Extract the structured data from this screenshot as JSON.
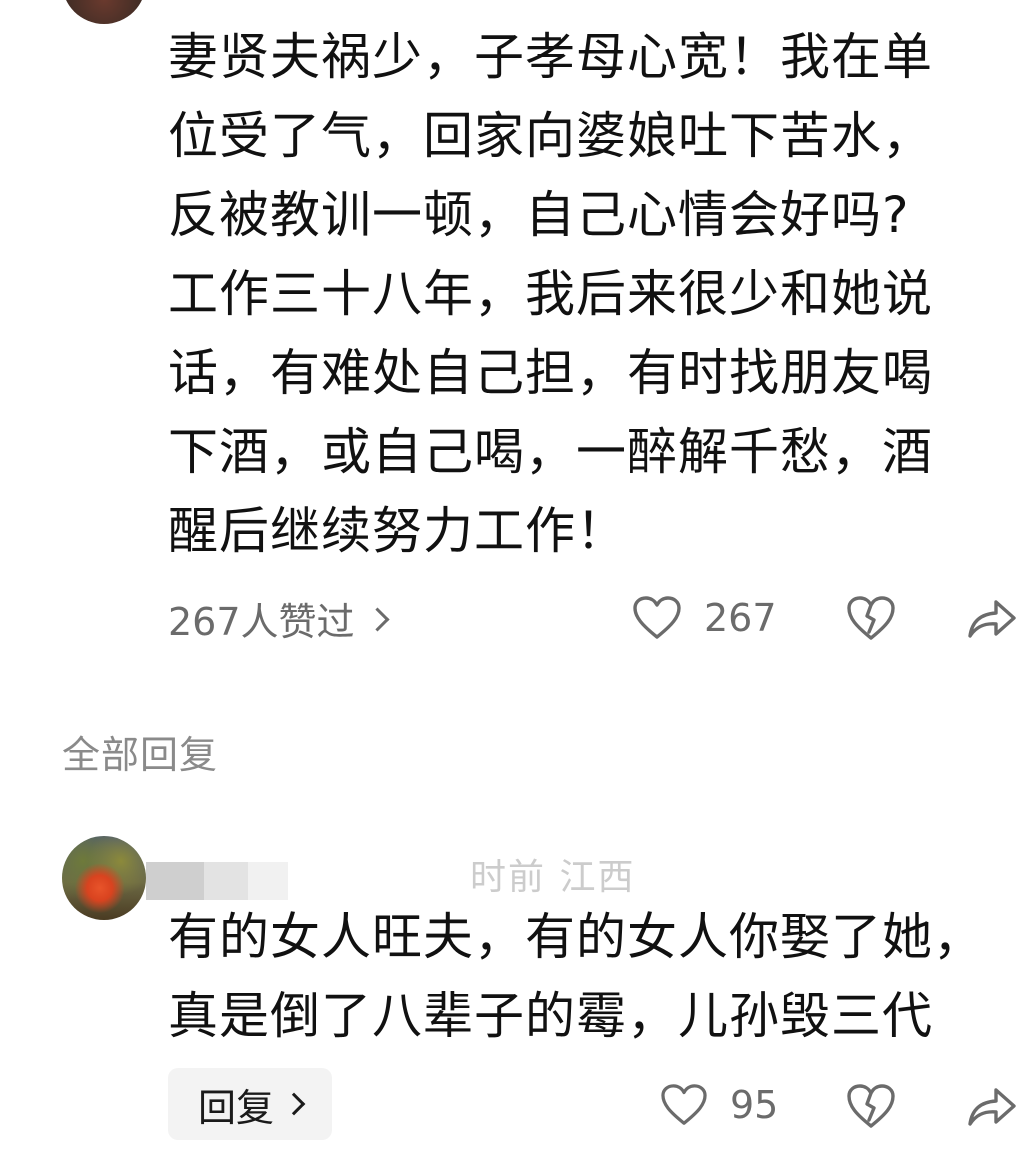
{
  "main_comment": {
    "text": "妻贤夫祸少，子孝母心宽！我在单\n位受了气，回家向婆娘吐下苦水，\n反被教训一顿，自己心情会好吗?\n工作三十八年，我后来很少和她说\n话，有难处自己担，有时找朋友喝\n下酒，或自己喝，一醉解千愁，酒\n醒后继续努力工作！",
    "likes_link_label": "267人赞过",
    "like_count": "267"
  },
  "replies_section": {
    "label": "全部回复"
  },
  "reply": {
    "meta_text": "时前 江西",
    "text": "有的女人旺夫，有的女人你娶了她，\n真是倒了八辈子的霉，儿孙毁三代",
    "reply_button_label": "回复",
    "like_count": "95"
  },
  "icons": {
    "like": "heart-outline-icon",
    "dislike": "broken-heart-icon",
    "share": "share-arrow-icon",
    "more": "chevron-right-icon"
  },
  "colors": {
    "text": "#111111",
    "secondary": "#6b6b6b",
    "section_label": "#8a8a8a",
    "button_bg": "#f3f3f3"
  }
}
